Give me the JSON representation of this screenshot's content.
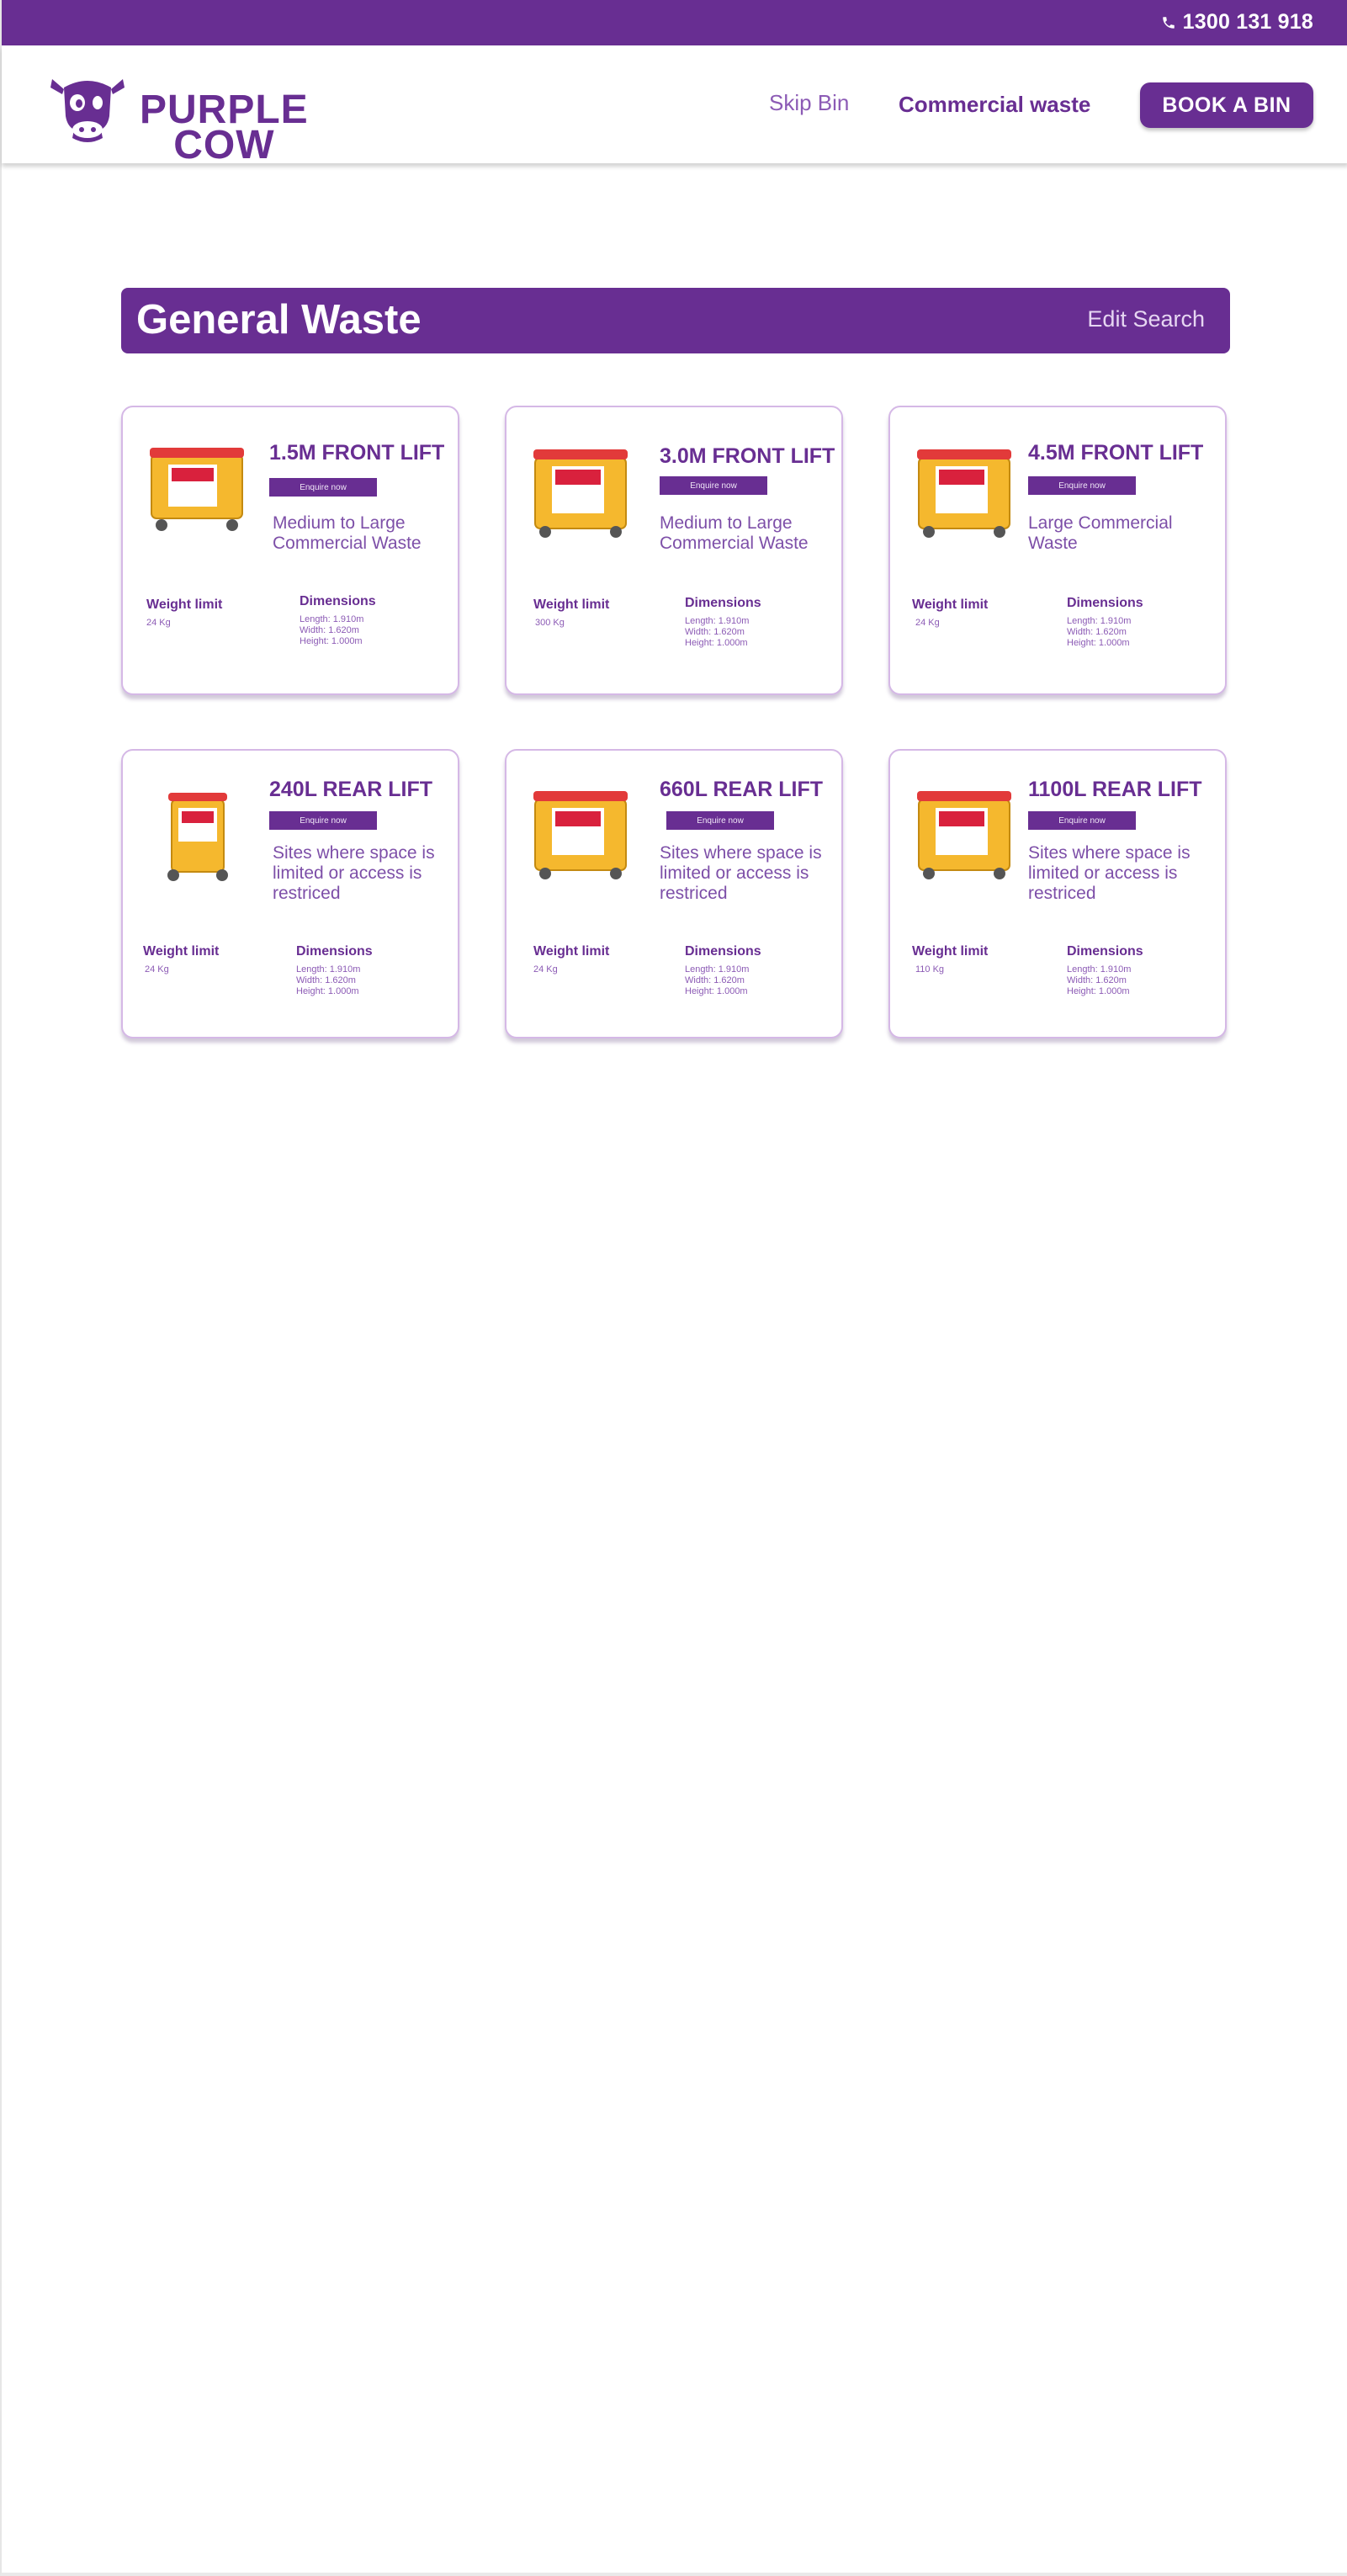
{
  "topbar": {
    "phone": "1300 131 918",
    "phone_icon": "phone-icon"
  },
  "brand": {
    "line1": "PURPLE",
    "line2": "COW",
    "logo_icon": "cow-head-icon",
    "color": "#682e92"
  },
  "nav": {
    "skip_bin": "Skip Bin",
    "commercial_waste": "Commercial waste",
    "book_button": "BOOK A BIN"
  },
  "page": {
    "title": "General Waste",
    "edit_search": "Edit Search"
  },
  "labels": {
    "weight_limit": "Weight limit",
    "dimensions": "Dimensions",
    "enquire": "Enquire now"
  },
  "cards": [
    {
      "title": "1.5M FRONT LIFT",
      "enquire": "Enquire now",
      "desc": "Medium to Large Commercial Waste",
      "weight": "24 Kg",
      "length": "Length: 1.910m",
      "width": "Width: 1.620m",
      "height": "Height: 1.000m",
      "bin_icon": "front-lift-bin-icon"
    },
    {
      "title": "3.0M FRONT LIFT",
      "enquire": "Enquire now",
      "desc": "Medium to Large Commercial Waste",
      "weight": "300 Kg",
      "length": "Length: 1.910m",
      "width": "Width: 1.620m",
      "height": "Height: 1.000m",
      "bin_icon": "front-lift-bin-icon"
    },
    {
      "title": "4.5M FRONT LIFT",
      "enquire": "Enquire now",
      "desc": "Large Commercial Waste",
      "weight": "24 Kg",
      "length": "Length: 1.910m",
      "width": "Width: 1.620m",
      "height": "Height: 1.000m",
      "bin_icon": "front-lift-bin-icon"
    },
    {
      "title": "240L REAR LIFT",
      "enquire": "Enquire now",
      "desc": "Sites where space is limited or access is restriced",
      "weight": "24 Kg",
      "length": "Length: 1.910m",
      "width": "Width: 1.620m",
      "height": "Height: 1.000m",
      "bin_icon": "wheelie-bin-icon"
    },
    {
      "title": "660L REAR LIFT",
      "enquire": "Enquire now",
      "desc": "Sites where space is limited or access is restriced",
      "weight": "24 Kg",
      "length": "Length: 1.910m",
      "width": "Width: 1.620m",
      "height": "Height: 1.000m",
      "bin_icon": "rear-lift-bin-icon"
    },
    {
      "title": "1100L REAR LIFT",
      "enquire": "Enquire now",
      "desc": "Sites where space is limited or access is restriced",
      "weight": "110 Kg",
      "length": "Length: 1.910m",
      "width": "Width: 1.620m",
      "height": "Height: 1.000m",
      "bin_icon": "rear-lift-bin-icon"
    }
  ]
}
